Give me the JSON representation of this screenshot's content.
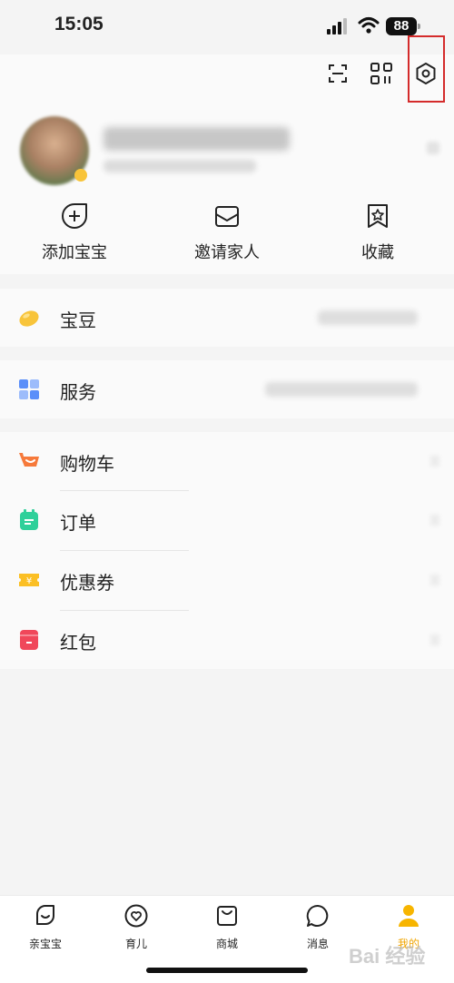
{
  "status_bar": {
    "time": "15:05",
    "battery": "88"
  },
  "header_icons": [
    "scan-icon",
    "qr-code-icon",
    "settings-icon"
  ],
  "quick_actions": [
    {
      "label": "添加宝宝",
      "icon": "add-baby-icon"
    },
    {
      "label": "邀请家人",
      "icon": "invite-mail-icon"
    },
    {
      "label": "收藏",
      "icon": "bookmark-star-icon"
    }
  ],
  "card1": {
    "label": "宝豆",
    "icon": "bean-icon"
  },
  "card2": {
    "label": "服务",
    "icon": "grid-icon"
  },
  "card3": {
    "items": [
      {
        "label": "购物车",
        "icon": "cart-icon"
      },
      {
        "label": "订单",
        "icon": "order-icon"
      },
      {
        "label": "优惠券",
        "icon": "coupon-icon"
      },
      {
        "label": "红包",
        "icon": "red-packet-icon"
      }
    ]
  },
  "tabs": [
    {
      "label": "亲宝宝",
      "icon": "leaf-icon"
    },
    {
      "label": "育儿",
      "icon": "heart-circle-icon"
    },
    {
      "label": "商城",
      "icon": "shopping-bag-icon"
    },
    {
      "label": "消息",
      "icon": "chat-bubble-icon"
    },
    {
      "label": "我的",
      "icon": "person-icon"
    }
  ],
  "watermark": "Bai 经验",
  "colors": {
    "accent": "#f0a500",
    "highlight_box": "#d42b2b"
  }
}
